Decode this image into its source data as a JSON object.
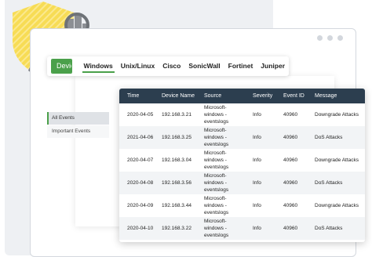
{
  "tabbar": {
    "devices_label": "Devices",
    "tabs": [
      {
        "label": "Windows",
        "active": true
      },
      {
        "label": "Unix/Linux",
        "active": false
      },
      {
        "label": "Cisco",
        "active": false
      },
      {
        "label": "SonicWall",
        "active": false
      },
      {
        "label": "Fortinet",
        "active": false
      },
      {
        "label": "Juniper",
        "active": false
      }
    ]
  },
  "side_menu": {
    "items": [
      {
        "label": "All Events",
        "active": true
      },
      {
        "label": "Important Events",
        "active": false
      }
    ]
  },
  "table": {
    "headers": [
      "Time",
      "Device Name",
      "Source",
      "Severity",
      "Event ID",
      "Message"
    ],
    "rows": [
      [
        "2020-04-05",
        "192.168.3.21",
        "Microsoft-windows - eventslogs",
        "Info",
        "40960",
        "Downgrade Attacks"
      ],
      [
        "2021-04-06",
        "192.168.3.25",
        "Microsoft-windows - eventslogs",
        "Info",
        "40960",
        "DoS Attacks"
      ],
      [
        "2020-04-07",
        "192.168.3.04",
        "Microsoft-windows - eventslogs",
        "Info",
        "40960",
        "Downgrade Attacks"
      ],
      [
        "2020-04-08",
        "192.168.3.56",
        "Microsoft-windows - eventslogs",
        "Info",
        "40960",
        "DoS Attacks"
      ],
      [
        "2020-04-09",
        "192.168.3.44",
        "Microsoft-windows - eventslogs",
        "Info",
        "40960",
        "Downgrade Attacks"
      ],
      [
        "2020-04-10",
        "192.168.3.22",
        "Microsoft-windows - eventslogs",
        "Info",
        "40960",
        "DoS Attacks"
      ]
    ]
  },
  "colors": {
    "accent_green": "#4aa04a",
    "table_header": "#2c3e4f",
    "shield_yellow": "#f5d94a"
  },
  "icons": [
    "shield-illustration",
    "magnifier-hand-illustration",
    "chevron-down-icon"
  ]
}
